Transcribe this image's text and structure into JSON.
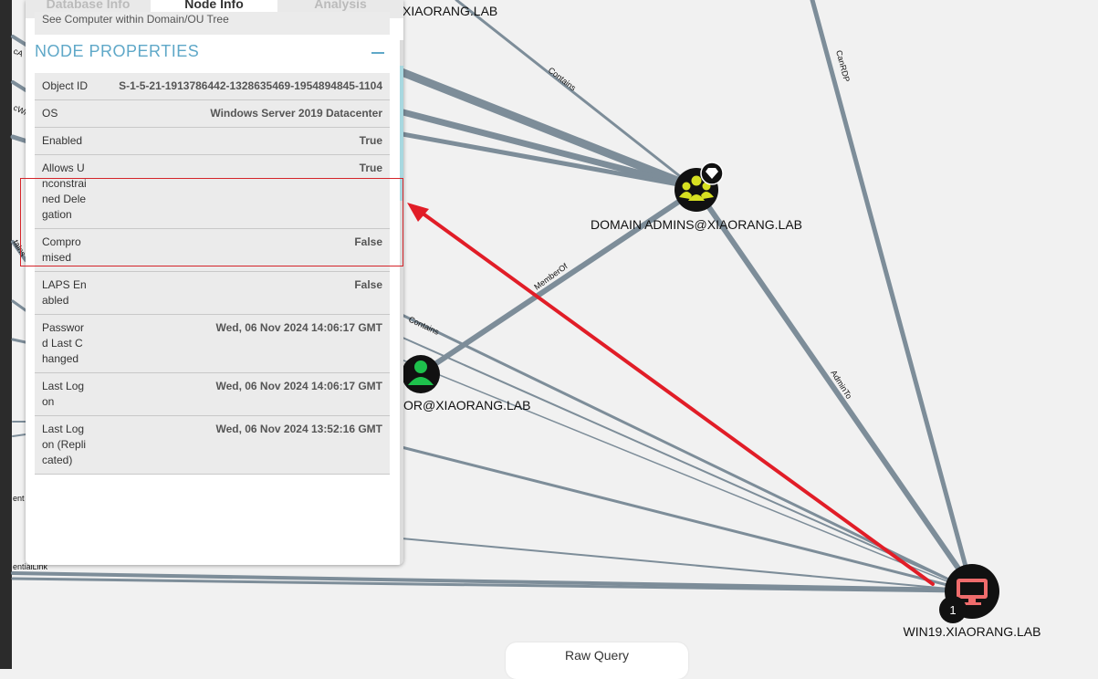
{
  "tabs": {
    "database": "Database Info",
    "node": "Node Info",
    "analysis": "Analysis"
  },
  "previous_row_text": "See Computer within Domain/OU Tree",
  "section_title": "NODE PROPERTIES",
  "properties": [
    {
      "key": "Object ID",
      "value": "S-1-5-21-1913786442-1328635469-1954894845-1104"
    },
    {
      "key": "OS",
      "value": "Windows Server 2019 Datacenter"
    },
    {
      "key": "Enabled",
      "value": "True"
    },
    {
      "key": "Allows Unconstrained Delegation",
      "value": "True"
    },
    {
      "key": "Compromised",
      "value": "False"
    },
    {
      "key": "LAPS Enabled",
      "value": "False"
    },
    {
      "key": "Password Last Changed",
      "value": "Wed, 06 Nov 2024 14:06:17 GMT"
    },
    {
      "key": "Last Logon",
      "value": "Wed, 06 Nov 2024 14:06:17 GMT"
    },
    {
      "key": "Last Logon (Replicated)",
      "value": "Wed, 06 Nov 2024 13:52:16 GMT"
    }
  ],
  "graph": {
    "nodes": {
      "top_domain": "XIAORANG.LAB",
      "domain_admins": "DOMAIN ADMINS@XIAORANG.LAB",
      "administrator": "OR@XIAORANG.LAB",
      "win19": "WIN19.XIAORANG.LAB",
      "win19_badge": "1"
    },
    "edges": {
      "contains_top": "Contains",
      "canrdp": "CanRDP",
      "memberof": "MemberOf",
      "contains_mid": "Contains",
      "adminto": "AdminTo",
      "left_1": "cA",
      "left_2": "cWr",
      "left_3": "tains",
      "left_4": "ent",
      "left_5": "entialLink"
    },
    "colors": {
      "edge": "#7d8d99",
      "arrow": "#e11d27",
      "group_node": "#d7e021",
      "user_node": "#1ec14c",
      "computer_node": "#ef6c6c"
    }
  },
  "raw_query_label": "Raw Query"
}
